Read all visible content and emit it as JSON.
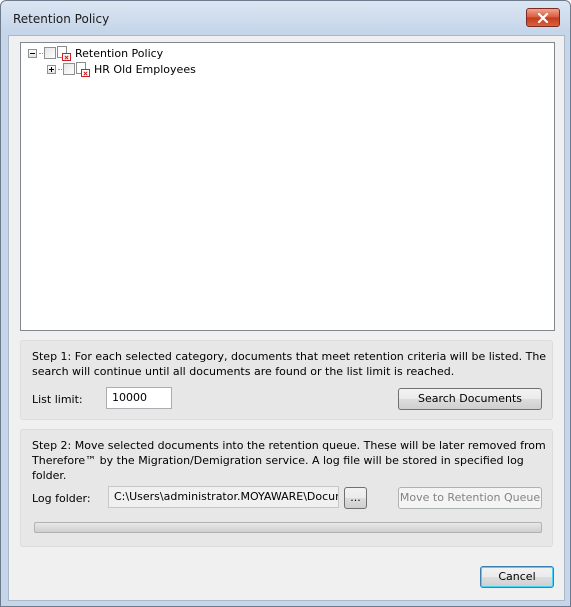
{
  "window": {
    "title": "Retention Policy"
  },
  "tree": {
    "items": [
      {
        "label": "Retention Policy",
        "expanded": true
      },
      {
        "label": "HR Old Employees",
        "expanded": false
      }
    ]
  },
  "step1": {
    "text": "Step 1: For each selected category, documents that meet retention criteria will be listed. The search will continue until all documents are found or the list limit is reached.",
    "list_limit_label": "List limit:",
    "list_limit_value": "10000",
    "search_button": "Search Documents"
  },
  "step2": {
    "text": "Step 2: Move selected documents into the retention queue. These will be later removed from Therefore™ by the Migration/Demigration service. A log file will be stored in specified log folder.",
    "log_folder_label": "Log folder:",
    "log_folder_value": "C:\\Users\\administrator.MOYAWARE\\Documents",
    "browse_button": "...",
    "move_button": "Move to Retention Queue",
    "progress": 0
  },
  "footer": {
    "cancel_button": "Cancel"
  }
}
